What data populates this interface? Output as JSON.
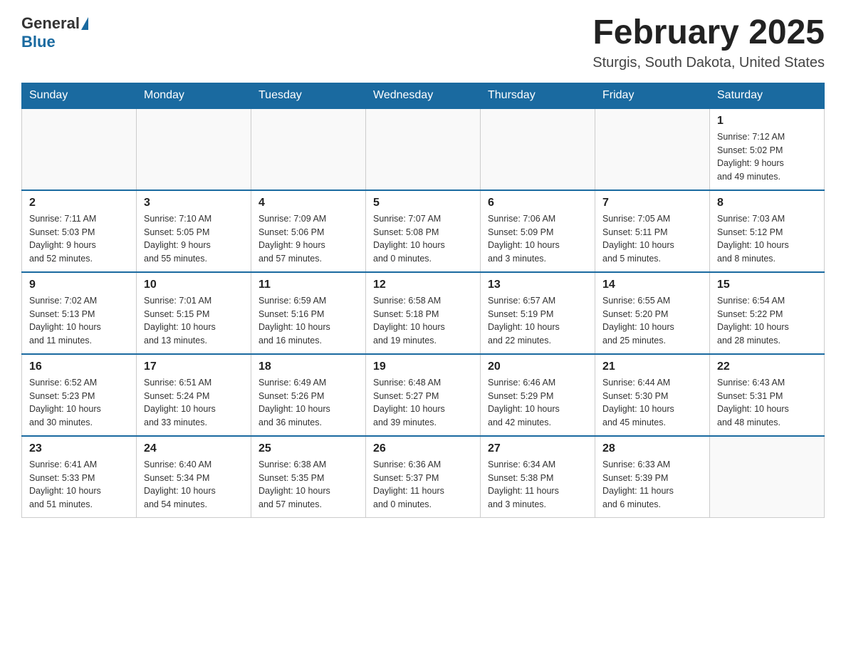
{
  "header": {
    "logo_general": "General",
    "logo_blue": "Blue",
    "month_title": "February 2025",
    "location": "Sturgis, South Dakota, United States"
  },
  "days_of_week": [
    "Sunday",
    "Monday",
    "Tuesday",
    "Wednesday",
    "Thursday",
    "Friday",
    "Saturday"
  ],
  "weeks": [
    {
      "days": [
        {
          "num": "",
          "info": ""
        },
        {
          "num": "",
          "info": ""
        },
        {
          "num": "",
          "info": ""
        },
        {
          "num": "",
          "info": ""
        },
        {
          "num": "",
          "info": ""
        },
        {
          "num": "",
          "info": ""
        },
        {
          "num": "1",
          "info": "Sunrise: 7:12 AM\nSunset: 5:02 PM\nDaylight: 9 hours\nand 49 minutes."
        }
      ]
    },
    {
      "days": [
        {
          "num": "2",
          "info": "Sunrise: 7:11 AM\nSunset: 5:03 PM\nDaylight: 9 hours\nand 52 minutes."
        },
        {
          "num": "3",
          "info": "Sunrise: 7:10 AM\nSunset: 5:05 PM\nDaylight: 9 hours\nand 55 minutes."
        },
        {
          "num": "4",
          "info": "Sunrise: 7:09 AM\nSunset: 5:06 PM\nDaylight: 9 hours\nand 57 minutes."
        },
        {
          "num": "5",
          "info": "Sunrise: 7:07 AM\nSunset: 5:08 PM\nDaylight: 10 hours\nand 0 minutes."
        },
        {
          "num": "6",
          "info": "Sunrise: 7:06 AM\nSunset: 5:09 PM\nDaylight: 10 hours\nand 3 minutes."
        },
        {
          "num": "7",
          "info": "Sunrise: 7:05 AM\nSunset: 5:11 PM\nDaylight: 10 hours\nand 5 minutes."
        },
        {
          "num": "8",
          "info": "Sunrise: 7:03 AM\nSunset: 5:12 PM\nDaylight: 10 hours\nand 8 minutes."
        }
      ]
    },
    {
      "days": [
        {
          "num": "9",
          "info": "Sunrise: 7:02 AM\nSunset: 5:13 PM\nDaylight: 10 hours\nand 11 minutes."
        },
        {
          "num": "10",
          "info": "Sunrise: 7:01 AM\nSunset: 5:15 PM\nDaylight: 10 hours\nand 13 minutes."
        },
        {
          "num": "11",
          "info": "Sunrise: 6:59 AM\nSunset: 5:16 PM\nDaylight: 10 hours\nand 16 minutes."
        },
        {
          "num": "12",
          "info": "Sunrise: 6:58 AM\nSunset: 5:18 PM\nDaylight: 10 hours\nand 19 minutes."
        },
        {
          "num": "13",
          "info": "Sunrise: 6:57 AM\nSunset: 5:19 PM\nDaylight: 10 hours\nand 22 minutes."
        },
        {
          "num": "14",
          "info": "Sunrise: 6:55 AM\nSunset: 5:20 PM\nDaylight: 10 hours\nand 25 minutes."
        },
        {
          "num": "15",
          "info": "Sunrise: 6:54 AM\nSunset: 5:22 PM\nDaylight: 10 hours\nand 28 minutes."
        }
      ]
    },
    {
      "days": [
        {
          "num": "16",
          "info": "Sunrise: 6:52 AM\nSunset: 5:23 PM\nDaylight: 10 hours\nand 30 minutes."
        },
        {
          "num": "17",
          "info": "Sunrise: 6:51 AM\nSunset: 5:24 PM\nDaylight: 10 hours\nand 33 minutes."
        },
        {
          "num": "18",
          "info": "Sunrise: 6:49 AM\nSunset: 5:26 PM\nDaylight: 10 hours\nand 36 minutes."
        },
        {
          "num": "19",
          "info": "Sunrise: 6:48 AM\nSunset: 5:27 PM\nDaylight: 10 hours\nand 39 minutes."
        },
        {
          "num": "20",
          "info": "Sunrise: 6:46 AM\nSunset: 5:29 PM\nDaylight: 10 hours\nand 42 minutes."
        },
        {
          "num": "21",
          "info": "Sunrise: 6:44 AM\nSunset: 5:30 PM\nDaylight: 10 hours\nand 45 minutes."
        },
        {
          "num": "22",
          "info": "Sunrise: 6:43 AM\nSunset: 5:31 PM\nDaylight: 10 hours\nand 48 minutes."
        }
      ]
    },
    {
      "days": [
        {
          "num": "23",
          "info": "Sunrise: 6:41 AM\nSunset: 5:33 PM\nDaylight: 10 hours\nand 51 minutes."
        },
        {
          "num": "24",
          "info": "Sunrise: 6:40 AM\nSunset: 5:34 PM\nDaylight: 10 hours\nand 54 minutes."
        },
        {
          "num": "25",
          "info": "Sunrise: 6:38 AM\nSunset: 5:35 PM\nDaylight: 10 hours\nand 57 minutes."
        },
        {
          "num": "26",
          "info": "Sunrise: 6:36 AM\nSunset: 5:37 PM\nDaylight: 11 hours\nand 0 minutes."
        },
        {
          "num": "27",
          "info": "Sunrise: 6:34 AM\nSunset: 5:38 PM\nDaylight: 11 hours\nand 3 minutes."
        },
        {
          "num": "28",
          "info": "Sunrise: 6:33 AM\nSunset: 5:39 PM\nDaylight: 11 hours\nand 6 minutes."
        },
        {
          "num": "",
          "info": ""
        }
      ]
    }
  ]
}
